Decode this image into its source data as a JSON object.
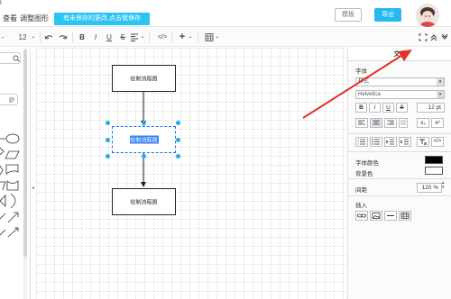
{
  "app": {
    "corner_label": "t",
    "menu": [
      "查看",
      "调整图形"
    ],
    "notice": "有未保存的更改,点击我保存",
    "buttons": {
      "secondary": "模板",
      "primary": "导出"
    }
  },
  "toolbar": {
    "left_edge": "-",
    "font_size": "12",
    "bold": "B",
    "italic": "I",
    "underline": "U",
    "strike": "S"
  },
  "canvas": {
    "nodes": [
      {
        "label": "绘制流程图",
        "selected": false
      },
      {
        "label": "绘制流程图",
        "selected": true
      },
      {
        "label": "绘制流程图",
        "selected": false
      }
    ]
  },
  "format_panel": {
    "tab": "文本",
    "font_label": "字体",
    "style_select": "样式",
    "font_select": "Helvetica",
    "bold": "B",
    "italic": "I",
    "underline": "U",
    "strike": "S",
    "font_size": "12 pt",
    "subscript": "x₂",
    "superscript": "x²",
    "code": "</>",
    "font_color_label": "字体颜色",
    "background_label": "背景色",
    "spacing_label": "间距",
    "spacing_value": "120 %",
    "insert_label": "插入",
    "colors": {
      "font": "#000000",
      "background": "#ffffff"
    }
  }
}
